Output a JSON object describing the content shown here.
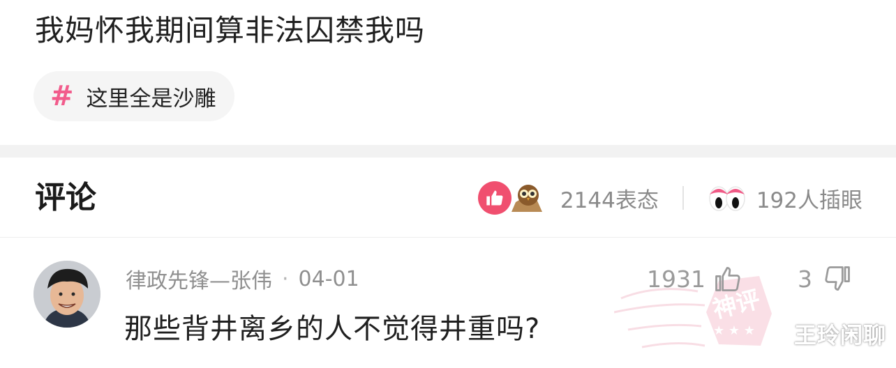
{
  "post": {
    "title": "我妈怀我期间算非法囚禁我吗",
    "topic": {
      "label": "这里全是沙雕",
      "icon": "hash-icon"
    }
  },
  "comments_section": {
    "title": "评论",
    "reactions": {
      "count_text": "2144表态",
      "eyes_text": "192人插眼",
      "like_color": "#f04f6f"
    }
  },
  "comment": {
    "author": "律政先锋—张伟",
    "separator": "·",
    "date": "04-01",
    "text": "那些背井离乡的人不觉得井重吗?",
    "likes": "1931",
    "dislikes": "3",
    "stamp_text": "神评"
  },
  "watermark": "王玲闲聊",
  "colors": {
    "accent": "#f25c8c",
    "muted_text": "#8f8f8f"
  }
}
